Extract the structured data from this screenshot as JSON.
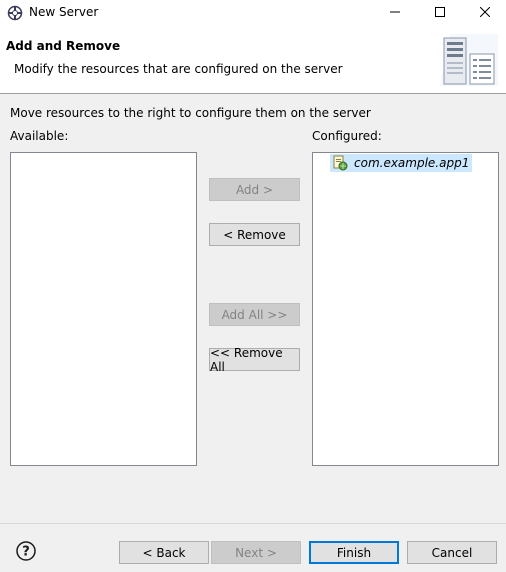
{
  "window": {
    "title": "New Server",
    "icons": {
      "app": "server-wizard-icon",
      "minimize": "minimize-icon",
      "maximize": "maximize-icon",
      "close": "close-icon"
    }
  },
  "header": {
    "title": "Add and Remove",
    "description": "Modify the resources that are configured on the server",
    "graphic": "server-graphic-icon"
  },
  "body": {
    "instruction": "Move resources to the right to configure them on the server",
    "available_label": "Available:",
    "configured_label": "Configured:",
    "available_items": [],
    "configured_items": [
      {
        "label": "com.example.app1",
        "icon": "web-module-icon",
        "selected": true
      }
    ]
  },
  "transfer_buttons": {
    "add": "Add >",
    "remove": "< Remove",
    "add_all": "Add All >>",
    "remove_all": "<< Remove All"
  },
  "footer": {
    "help_icon": "help-icon",
    "back": "< Back",
    "next": "Next >",
    "finish": "Finish",
    "cancel": "Cancel"
  },
  "colors": {
    "selection": "#cce8ff",
    "default_button_border": "#0078d7",
    "disabled_text": "#838383"
  }
}
